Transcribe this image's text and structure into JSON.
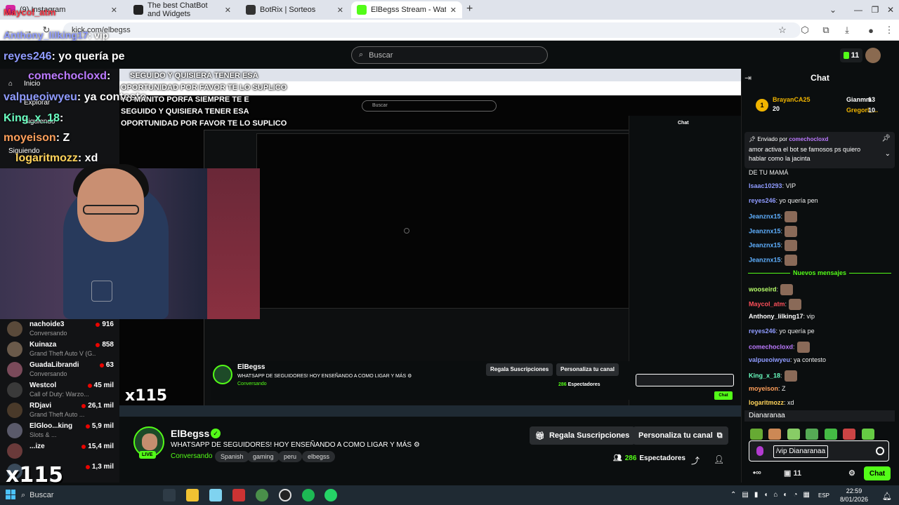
{
  "browser": {
    "tabs": [
      {
        "label": "(9) Instagram",
        "icon": "instagram-icon"
      },
      {
        "label": "The best ChatBot and Widgets",
        "icon": "botrix-icon"
      },
      {
        "label": "BotRix | Sorteos",
        "icon": "botrix-icon"
      },
      {
        "label": "ElBegss Stream - Watch Live o",
        "icon": "kick-icon"
      }
    ],
    "new_tab": "+",
    "url": "kick.com/elbegss"
  },
  "header": {
    "search_placeholder": "Buscar",
    "credits": "11"
  },
  "overlay_chat": [
    {
      "user": "Maycol_atm",
      "text": ""
    },
    {
      "user": "Anthony_lilking17",
      "text": ": vip"
    },
    {
      "user": "reyes246",
      "text": ": yo quería pe"
    },
    {
      "user": "comechocloxd",
      "text": ":"
    },
    {
      "user": "valpueoiwyeu",
      "text": ": ya contesto"
    },
    {
      "user": "King_x_18",
      "text": ":"
    },
    {
      "user": "moyeison",
      "text": ": Z"
    },
    {
      "user": "logaritmozz",
      "text": ": xd"
    }
  ],
  "overlay_banner": [
    "SEGUIDO Y QUISIERA TENER ESA",
    "OPORTUNIDAD POR FAVOR TE LO SUPLICO",
    "YO MANITO PORFA SIEMPRE TE E",
    "SEGUIDO Y QUISIERA TENER ESA",
    "OPORTUNIDAD POR FAVOR TE LO SUPLICO"
  ],
  "overlay_multiplier": "x115",
  "sidebar_nav": [
    "Inicio",
    "Explorar",
    "Siguiendo"
  ],
  "sidebar": [
    {
      "name": "nachoide3",
      "game": "Conversando",
      "viewers": "916",
      "color": "#5a4a3a"
    },
    {
      "name": "Kuinaza",
      "game": "Grand Theft Auto V (G...",
      "viewers": "858",
      "color": "#6a5a4a"
    },
    {
      "name": "GuadaLibrandi",
      "game": "Conversando",
      "viewers": "63",
      "color": "#7a4a5a"
    },
    {
      "name": "Westcol",
      "game": "Call of Duty: Warzo...",
      "viewers": "45 mil",
      "color": "#3a3a3a"
    },
    {
      "name": "RDjavi",
      "game": "Grand Theft Auto ...",
      "viewers": "26,1 mil",
      "color": "#4a3a2a"
    },
    {
      "name": "ElGloo...king",
      "game": "Slots & ...",
      "viewers": "5,9 mil",
      "color": "#5a5a6a"
    },
    {
      "name": "...ize",
      "game": "",
      "viewers": "15,4 mil",
      "color": "#6a3a3a"
    },
    {
      "name": "",
      "game": "",
      "viewers": "1,3 mil",
      "color": "#3a4a5a"
    }
  ],
  "stream": {
    "name": "ElBegss",
    "live": "LIVE",
    "title": "WHATSAPP DE SEGUIDORES! HOY ENSEÑANDO A COMO LIGAR Y MÁS ⚙",
    "category": "Conversando",
    "tags": [
      "Spanish",
      "gaming",
      "peru",
      "elbegss"
    ],
    "gift_button": "Regala Suscripciones",
    "customize_button": "Personaliza tu canal",
    "viewers": "286",
    "viewers_label": "Espectadores"
  },
  "chat": {
    "title": "Chat",
    "donors": [
      {
        "rank": "1",
        "name": "BrayanCA25",
        "amount": "20"
      },
      {
        "rank": "",
        "name": "Gianmm",
        "amount": "13"
      },
      {
        "rank": "",
        "name": "Gregori_...",
        "amount": "10"
      }
    ],
    "pinned_by_label": "Enviado por",
    "pinned_by_user": "comechocloxd",
    "pinned_text_1": "amor activa el bot se famosos ps quiero",
    "pinned_text_2": "hablar como la jacinta",
    "partial_line": "DE TU MAMÁ",
    "messages": [
      {
        "user": "Isaac10293",
        "text": ": VIP",
        "color": "#8f9bff"
      },
      {
        "user": "reyes246",
        "text": ": yo quería pen",
        "color": "#8f9bff"
      },
      {
        "user": "Jeanznx15",
        "text": ":",
        "color": "#5fb0ff"
      },
      {
        "user": "Jeanznx15",
        "text": ":",
        "color": "#5fb0ff"
      },
      {
        "user": "Jeanznx15",
        "text": ":",
        "color": "#5fb0ff"
      },
      {
        "user": "Jeanznx15",
        "text": ":",
        "color": "#5fb0ff"
      }
    ],
    "new_messages": "Nuevos mensajes",
    "messages2": [
      {
        "user": "wooseird",
        "text": ":",
        "color": "#b8ff6a"
      },
      {
        "user": "Maycol_atm",
        "text": ":",
        "color": "#ff4f5a"
      },
      {
        "user": "Anthony_lilking17",
        "text": ": vip",
        "color": "#fff"
      },
      {
        "user": "reyes246",
        "text": ": yo quería pe",
        "color": "#8f9bff"
      },
      {
        "user": "comechocloxd",
        "text": ":",
        "color": "#bc7aff"
      },
      {
        "user": "valpueoiwyeu",
        "text": ": ya contesto",
        "color": "#8f9bff"
      },
      {
        "user": "King_x_18",
        "text": ":",
        "color": "#6affc1"
      },
      {
        "user": "moyeison",
        "text": ": Z",
        "color": "#ff9f5a"
      },
      {
        "user": "logaritmozz",
        "text": ": xd",
        "color": "#ffd35a"
      }
    ],
    "suggestion": "Dianaranaa",
    "input_value": "/vip Dianaranaa",
    "infinity": "∞",
    "count": "11",
    "send_label": "Chat"
  },
  "taskbar": {
    "search": "Buscar",
    "lang": "ESP",
    "time": "22:59",
    "date": "8/01/2026"
  },
  "colors": {
    "accent": "#53fc18",
    "live_red": "#eb0400"
  }
}
